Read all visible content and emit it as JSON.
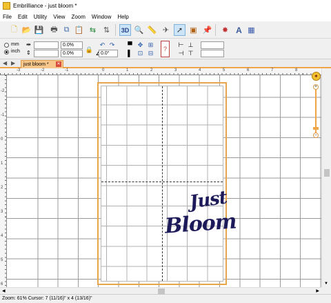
{
  "window": {
    "title": "Embrilliance - just bloom *"
  },
  "menu": [
    "File",
    "Edit",
    "Utility",
    "View",
    "Zoom",
    "Window",
    "Help"
  ],
  "toolbar": {
    "icons": [
      "new-icon",
      "open-icon",
      "save-icon",
      "print-icon",
      "copy-icon",
      "paste-icon",
      "mirror-icon",
      "flip-icon",
      "3d-view-icon",
      "magnify-icon",
      "ruler-icon",
      "plane-icon",
      "select-icon",
      "hoop-icon",
      "pin-icon",
      "wand-icon",
      "lettering-icon",
      "color-icon"
    ],
    "view_3d_label": "3D",
    "text_tool_label": "A"
  },
  "props": {
    "unit_mm": "mm",
    "unit_inch": "inch",
    "selected_unit": "inch",
    "width_value": "",
    "width_pct": "0.0%",
    "height_value": "",
    "height_pct": "0.0%",
    "rotation": "0.0°",
    "rotation_field": ""
  },
  "tabs": {
    "document": "just bloom *"
  },
  "rulers": {
    "top": [
      "-3",
      "-2",
      "-1",
      "0",
      "1",
      "2",
      "3",
      "4",
      "5",
      "6",
      "7",
      "8"
    ],
    "left": [
      "-2",
      "-1",
      "0",
      "1",
      "2",
      "3",
      "4",
      "5",
      "6"
    ]
  },
  "design": {
    "line1": "Just",
    "line2": "Bloom",
    "thread_color": "#1d1a5a",
    "hoop_color": "#e8a64a"
  },
  "status": {
    "zoom": "Zoom: 61%",
    "cursor": "Cursor: 7 (11/16)\" x 4 (13/16)\""
  },
  "colors": {
    "tab_accent": "#f0a548",
    "grid": "#9a9a9a"
  }
}
